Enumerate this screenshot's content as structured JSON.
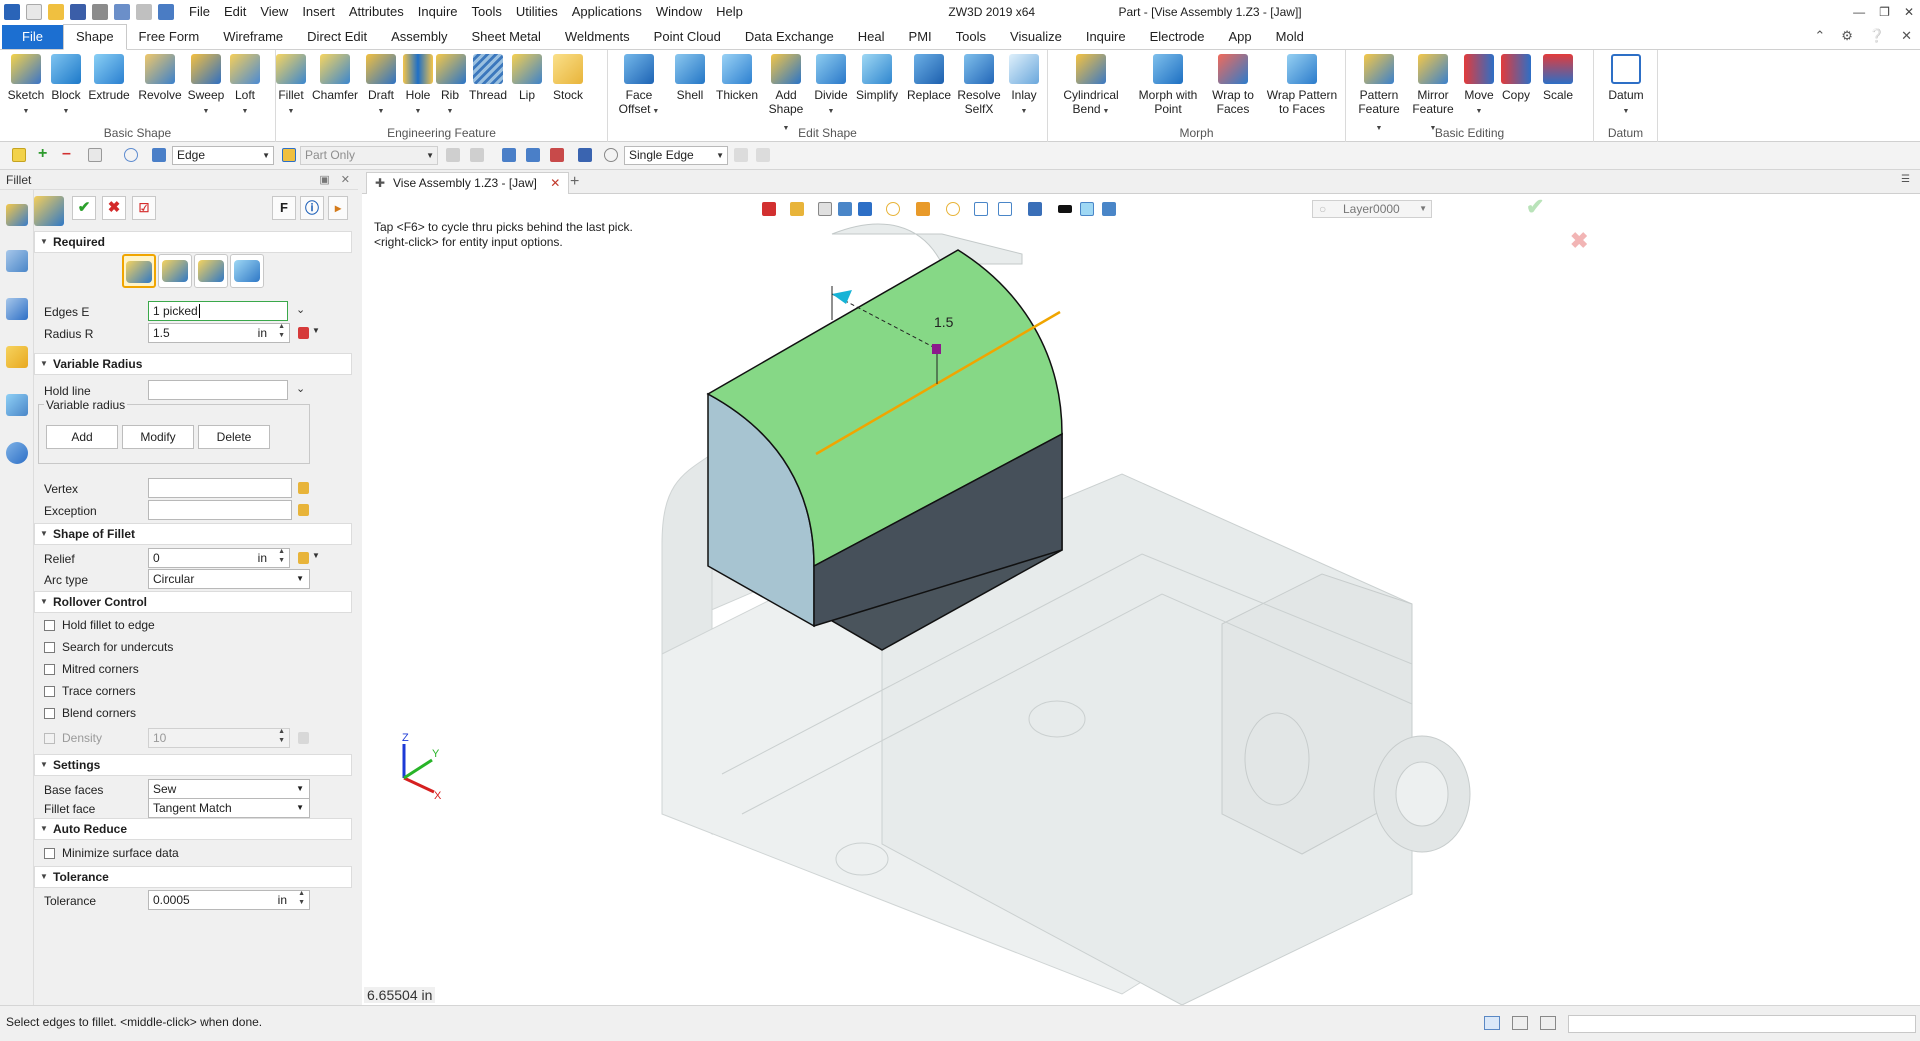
{
  "app": {
    "title": "ZW3D 2019  x64",
    "document_title": "Part - [Vise Assembly 1.Z3 - [Jaw]]",
    "menu": [
      "File",
      "Edit",
      "View",
      "Insert",
      "Attributes",
      "Inquire",
      "Tools",
      "Utilities",
      "Applications",
      "Window",
      "Help"
    ]
  },
  "ribbon_tabs": [
    "File",
    "Shape",
    "Free Form",
    "Wireframe",
    "Direct Edit",
    "Assembly",
    "Sheet Metal",
    "Weldments",
    "Point Cloud",
    "Data Exchange",
    "Heal",
    "PMI",
    "Tools",
    "Visualize",
    "Inquire",
    "Electrode",
    "App",
    "Mold"
  ],
  "ribbon": {
    "basic_shape": {
      "title": "Basic Shape",
      "buttons": [
        "Sketch",
        "Block",
        "Extrude",
        "Revolve",
        "Sweep",
        "Loft"
      ]
    },
    "engineering_feature": {
      "title": "Engineering Feature",
      "buttons": [
        "Fillet",
        "Chamfer",
        "Draft",
        "Hole",
        "Rib",
        "Thread",
        "Lip",
        "Stock"
      ]
    },
    "edit_shape": {
      "title": "Edit Shape",
      "buttons": [
        "Face\nOffset",
        "Shell",
        "Thicken",
        "Add\nShape",
        "Divide",
        "Simplify",
        "Replace",
        "Resolve\nSelfX",
        "Inlay"
      ]
    },
    "morph": {
      "title": "Morph",
      "buttons": [
        "Cylindrical\nBend",
        "Morph with\nPoint",
        "Wrap to\nFaces",
        "Wrap Pattern\nto Faces"
      ]
    },
    "basic_editing": {
      "title": "Basic Editing",
      "buttons": [
        "Pattern\nFeature",
        "Mirror\nFeature",
        "Move",
        "Copy",
        "Scale"
      ]
    },
    "datum": {
      "title": "Datum",
      "buttons": [
        "Datum"
      ]
    }
  },
  "toolbar": {
    "filter": "Edge",
    "scope": "Part Only",
    "pick_mode": "Single Edge"
  },
  "panel": {
    "title": "Fillet",
    "f_button": "F",
    "required": {
      "title": "Required",
      "edges_label": "Edges E",
      "edges_value": "1 picked",
      "radius_label": "Radius R",
      "radius_value": "1.5",
      "radius_unit": "in"
    },
    "variable_radius": {
      "title": "Variable Radius",
      "hold_line_label": "Hold line",
      "group_label": "Variable radius",
      "add": "Add",
      "modify": "Modify",
      "delete": "Delete",
      "vertex_label": "Vertex",
      "exception_label": "Exception"
    },
    "shape_of_fillet": {
      "title": "Shape of Fillet",
      "relief_label": "Relief",
      "relief_value": "0",
      "relief_unit": "in",
      "arc_type_label": "Arc type",
      "arc_type_value": "Circular"
    },
    "rollover": {
      "title": "Rollover Control",
      "options": [
        "Hold fillet to edge",
        "Search for undercuts",
        "Mitred corners",
        "Trace corners",
        "Blend corners"
      ],
      "density_label": "Density",
      "density_value": "10"
    },
    "settings": {
      "title": "Settings",
      "base_faces_label": "Base faces",
      "base_faces_value": "Sew",
      "fillet_face_label": "Fillet face",
      "fillet_face_value": "Tangent Match"
    },
    "auto_reduce": {
      "title": "Auto Reduce",
      "minimize_label": "Minimize surface data"
    },
    "tolerance": {
      "title": "Tolerance",
      "label": "Tolerance",
      "value": "0.0005",
      "unit": "in"
    }
  },
  "doc_tab": "Vise Assembly 1.Z3 - [Jaw]",
  "viewport": {
    "hint_line1": "Tap <F6> to cycle thru picks behind the last pick.",
    "hint_line2": "<right-click> for entity input options.",
    "layer": "Layer0000",
    "dimension": "1.5",
    "coord": "6.65504 in",
    "axes": {
      "x": "X",
      "y": "Y",
      "z": "Z"
    }
  },
  "status": {
    "message": "Select edges to fillet.  <middle-click> when done."
  },
  "colors": {
    "accent": "#1c6fd1",
    "fillet_face": "#7ed67e",
    "selected_edge": "#f0a500"
  }
}
